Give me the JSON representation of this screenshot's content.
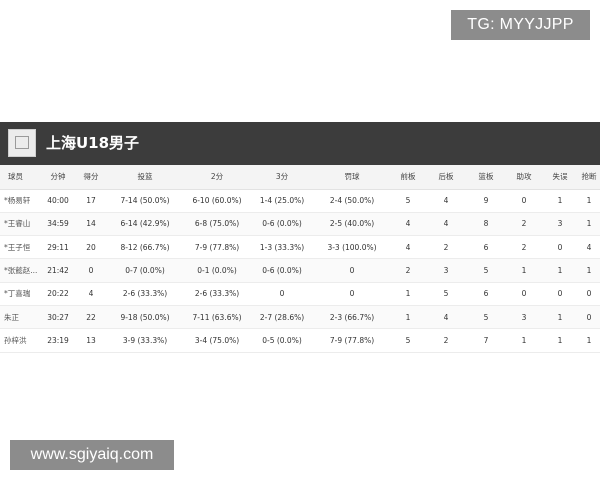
{
  "watermarks": {
    "top": "TG: MYYJJPP",
    "bottom": "www.sgiyaiq.com"
  },
  "team": {
    "name": "上海U18男子"
  },
  "table": {
    "headers": [
      "球员",
      "分钟",
      "得分",
      "投篮",
      "2分",
      "3分",
      "罚球",
      "前板",
      "后板",
      "篮板",
      "助攻",
      "失误",
      "抢断"
    ],
    "rows": [
      [
        "*杨易轩",
        "40:00",
        "17",
        "7-14 (50.0%)",
        "6-10 (60.0%)",
        "1-4 (25.0%)",
        "2-4 (50.0%)",
        "5",
        "4",
        "9",
        "0",
        "1",
        "1"
      ],
      [
        "*王睿山",
        "34:59",
        "14",
        "6-14 (42.9%)",
        "6-8 (75.0%)",
        "0-6 (0.0%)",
        "2-5 (40.0%)",
        "4",
        "4",
        "8",
        "2",
        "3",
        "1"
      ],
      [
        "*王子恒",
        "29:11",
        "20",
        "8-12 (66.7%)",
        "7-9 (77.8%)",
        "1-3 (33.3%)",
        "3-3 (100.0%)",
        "4",
        "2",
        "6",
        "2",
        "0",
        "4"
      ],
      [
        "*张懿赵...",
        "21:42",
        "0",
        "0-7 (0.0%)",
        "0-1 (0.0%)",
        "0-6 (0.0%)",
        "0",
        "2",
        "3",
        "5",
        "1",
        "1",
        "1"
      ],
      [
        "*丁喜瑞",
        "20:22",
        "4",
        "2-6 (33.3%)",
        "2-6 (33.3%)",
        "0",
        "0",
        "1",
        "5",
        "6",
        "0",
        "0",
        "0"
      ],
      [
        "朱正",
        "30:27",
        "22",
        "9-18 (50.0%)",
        "7-11 (63.6%)",
        "2-7 (28.6%)",
        "2-3 (66.7%)",
        "1",
        "4",
        "5",
        "3",
        "1",
        "0"
      ],
      [
        "孙梓洪",
        "23:19",
        "13",
        "3-9 (33.3%)",
        "3-4 (75.0%)",
        "0-5 (0.0%)",
        "7-9 (77.8%)",
        "5",
        "2",
        "7",
        "1",
        "1",
        "1"
      ]
    ]
  }
}
